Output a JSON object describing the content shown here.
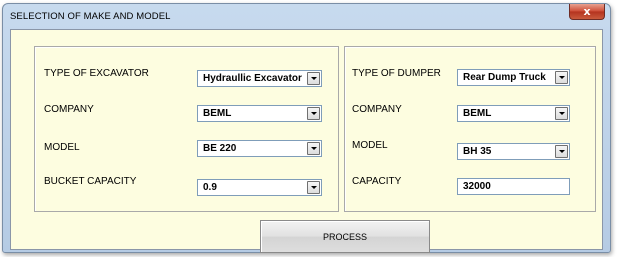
{
  "window": {
    "title": "SELECTION OF MAKE AND MODEL",
    "close_glyph": "x"
  },
  "excavator": {
    "type_label": "TYPE OF EXCAVATOR",
    "type_value": "Hydraullic Excavator",
    "company_label": "COMPANY",
    "company_value": "BEML",
    "model_label": "MODEL",
    "model_value": "BE 220",
    "bucket_label": "BUCKET CAPACITY",
    "bucket_value": "0.9"
  },
  "dumper": {
    "type_label": "TYPE OF DUMPER",
    "type_value": "Rear Dump Truck",
    "company_label": "COMPANY",
    "company_value": "BEML",
    "model_label": "MODEL",
    "model_value": "BH 35",
    "capacity_label": "CAPACITY",
    "capacity_value": "32000"
  },
  "actions": {
    "process_label": "PROCESS"
  },
  "icons": {
    "close": "close-icon",
    "dropdown": "chevron-down-icon"
  },
  "colors": {
    "client_background": "#fdfde0",
    "close_button": "#c9432f",
    "window_frame": "#b9cde5"
  }
}
